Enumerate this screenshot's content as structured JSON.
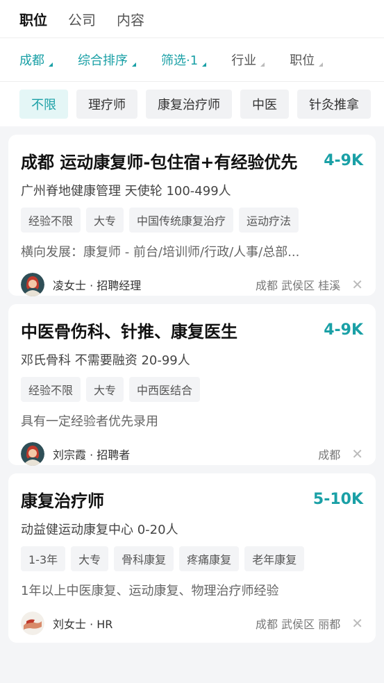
{
  "top_tabs": [
    "职位",
    "公司",
    "内容"
  ],
  "filters": [
    {
      "label": "成都",
      "style": "teal"
    },
    {
      "label": "综合排序",
      "style": "teal"
    },
    {
      "label": "筛选·1",
      "style": "teal"
    },
    {
      "label": "行业",
      "style": "gray"
    },
    {
      "label": "职位",
      "style": "gray"
    }
  ],
  "chips": [
    "不限",
    "理疗师",
    "康复治疗师",
    "中医",
    "针灸推拿"
  ],
  "jobs": [
    {
      "title": "成都 运动康复师-包住宿+有经验优先",
      "salary": "4-9K",
      "company": "广州脊地健康管理 天使轮 100-499人",
      "tags": [
        "经验不限",
        "大专",
        "中国传统康复治疗",
        "运动疗法"
      ],
      "desc": "横向发展：康复师 - 前台/培训师/行政/人事/总部...",
      "recruiter": "凌女士 · 招聘经理",
      "location": "成都 武侯区 桂溪",
      "avatar_icon": "woman-avatar-icon"
    },
    {
      "title": "中医骨伤科、针推、康复医生",
      "salary": "4-9K",
      "company": "邓氏骨科 不需要融资 20-99人",
      "tags": [
        "经验不限",
        "大专",
        "中西医结合"
      ],
      "desc": "具有一定经验者优先录用",
      "recruiter": "刘宗霞 · 招聘者",
      "location": "成都",
      "avatar_icon": "woman-avatar-icon"
    },
    {
      "title": "康复治疗师",
      "salary": "5-10K",
      "company": "动益健运动康复中心 0-20人",
      "tags": [
        "1-3年",
        "大专",
        "骨科康复",
        "疼痛康复",
        "老年康复"
      ],
      "desc": "1年以上中医康复、运动康复、物理治疗师经验",
      "recruiter": "刘女士 · HR",
      "location": "成都 武侯区 丽都",
      "avatar_icon": "hands-avatar-icon"
    }
  ],
  "colors": {
    "accent": "#1aa0a6",
    "background": "#f4f5f7"
  }
}
